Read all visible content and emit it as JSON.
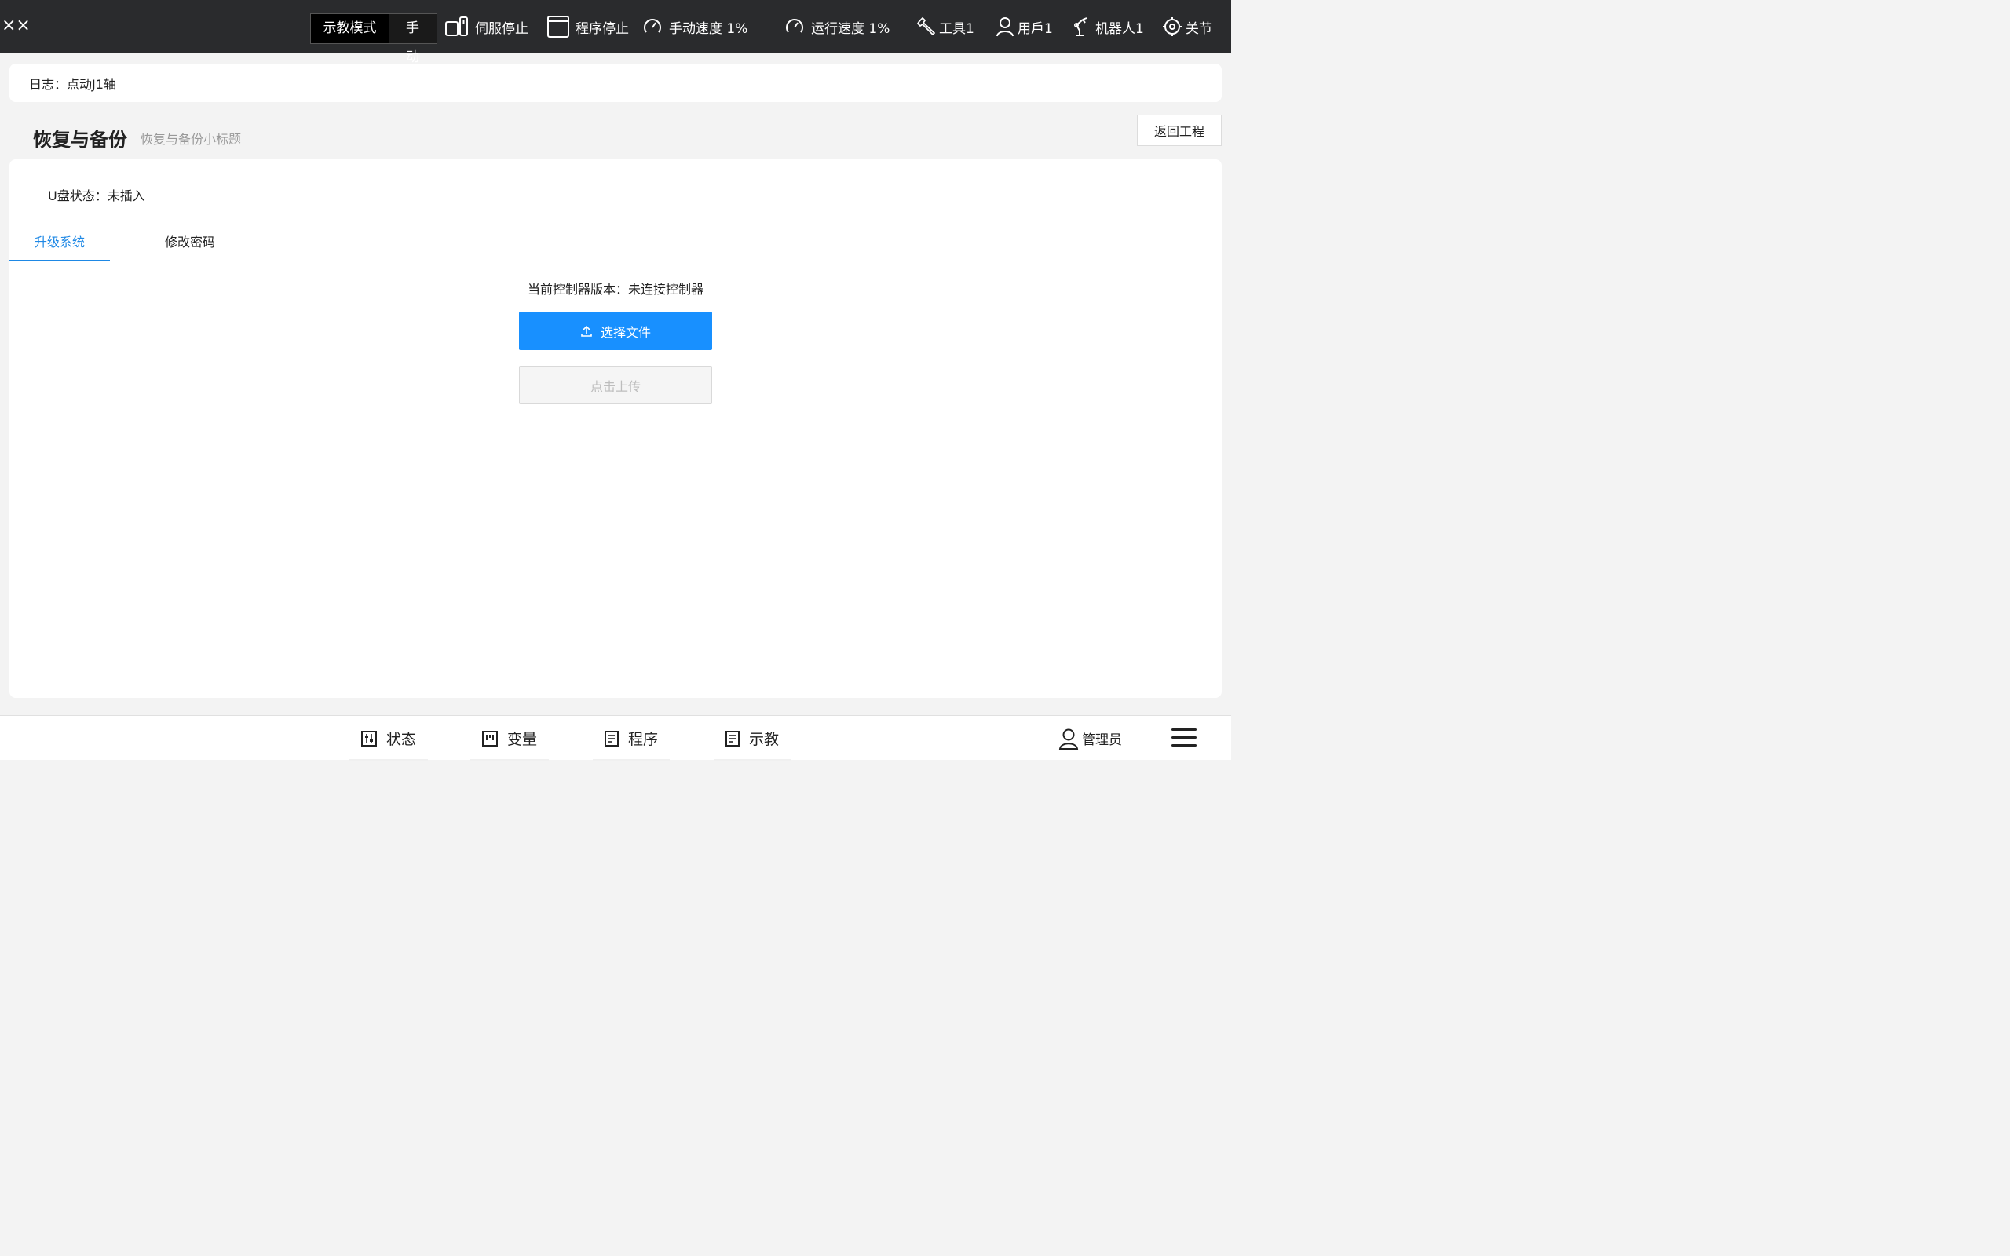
{
  "topbar": {
    "brand": "××",
    "mode_label": "示教模式",
    "mode_value": "手动",
    "servo": "伺服停止",
    "program": "程序停止",
    "manual_speed": "手动速度 1%",
    "run_speed": "运行速度 1%",
    "tool": "工具1",
    "user": "用戶1",
    "robot": "机器人1",
    "joint": "关节"
  },
  "log": {
    "text": "日志：点动J1轴"
  },
  "header": {
    "title": "恢复与备份",
    "subtitle": "恢复与备份小标题",
    "back_label": "返回工程"
  },
  "card": {
    "usb_status": "U盘状态：未插入",
    "tabs": [
      {
        "label": "升级系统",
        "active": true
      },
      {
        "label": "修改密码",
        "active": false
      }
    ],
    "version_text": "当前控制器版本：未连接控制器",
    "select_file_label": "选择文件",
    "upload_label": "点击上传"
  },
  "bottomnav": {
    "items": [
      {
        "label": "状态",
        "icon": "sliders-icon"
      },
      {
        "label": "变量",
        "icon": "variable-icon"
      },
      {
        "label": "程序",
        "icon": "program-icon"
      },
      {
        "label": "示教",
        "icon": "teach-icon"
      }
    ],
    "admin_label": "管理员"
  },
  "colors": {
    "topbar_bg": "#2a2b2d",
    "accent": "#1890ff",
    "tab_active": "#1e88e5",
    "page_bg": "#f3f3f3"
  }
}
